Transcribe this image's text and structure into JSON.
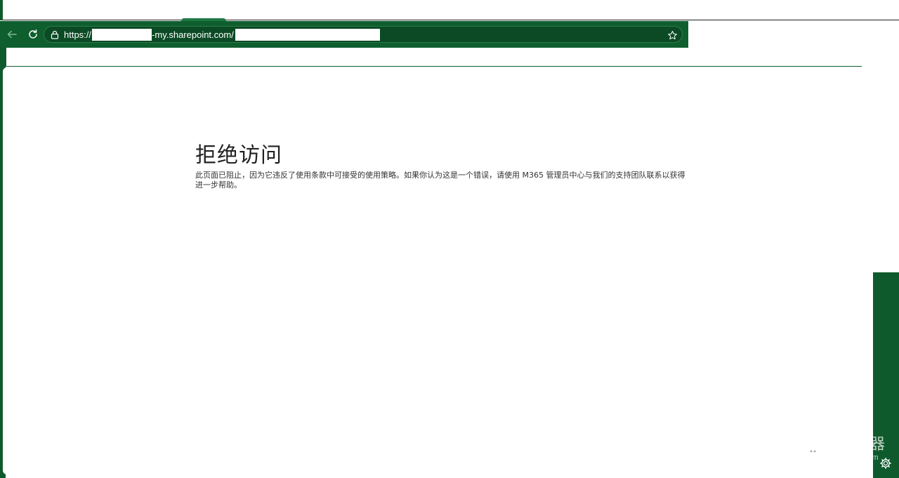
{
  "browser": {
    "url_prefix": "https://",
    "url_middle": "-my.sharepoint.com/",
    "icons": {
      "back": "arrow-left-icon",
      "reload": "reload-icon",
      "lock": "lock-icon",
      "favorite": "star-icon"
    }
  },
  "page": {
    "title": "拒绝访问",
    "message": "此页面已阻止，因为它违反了使用条款中可接受的使用策略。如果你认为这是一个错误，请使用 M365 管理员中心与我们的支持团队联系以获得进一步帮助。"
  },
  "watermark": {
    "name": "路由器",
    "domain": "luyouqi.com"
  },
  "colors": {
    "brand_green": "#0e5e2e",
    "text_dark": "#222222"
  }
}
